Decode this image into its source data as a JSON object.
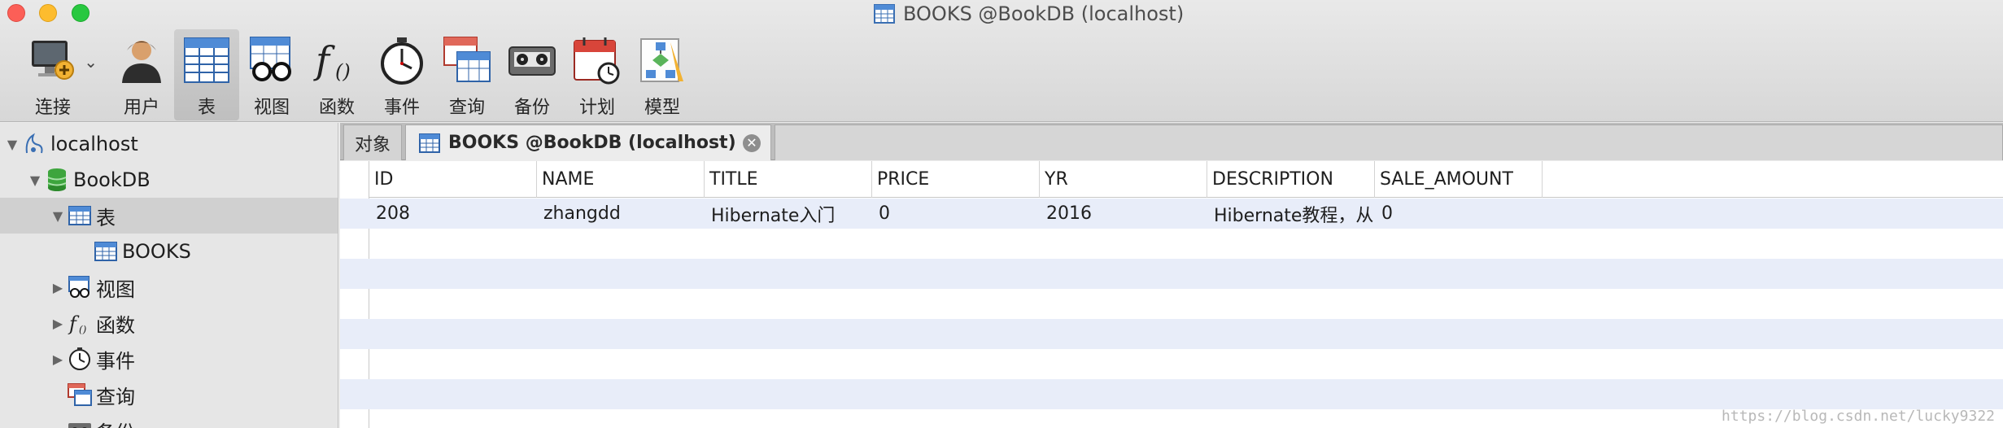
{
  "window": {
    "title": "BOOKS @BookDB (localhost)"
  },
  "toolbar": {
    "items": [
      {
        "label": "连接",
        "icon": "connection-icon"
      },
      {
        "label": "用户",
        "icon": "user-icon"
      },
      {
        "label": "表",
        "icon": "table-icon",
        "active": true
      },
      {
        "label": "视图",
        "icon": "view-icon"
      },
      {
        "label": "函数",
        "icon": "function-icon"
      },
      {
        "label": "事件",
        "icon": "event-icon"
      },
      {
        "label": "查询",
        "icon": "query-icon"
      },
      {
        "label": "备份",
        "icon": "backup-icon"
      },
      {
        "label": "计划",
        "icon": "schedule-icon"
      },
      {
        "label": "模型",
        "icon": "model-icon"
      }
    ]
  },
  "sidebar": {
    "tree": [
      {
        "label": "localhost",
        "icon": "server-icon"
      },
      {
        "label": "BookDB",
        "icon": "database-icon"
      },
      {
        "label": "表",
        "icon": "table-icon"
      },
      {
        "label": "BOOKS",
        "icon": "table-icon"
      },
      {
        "label": "视图",
        "icon": "view-icon"
      },
      {
        "label": "函数",
        "icon": "function-icon"
      },
      {
        "label": "事件",
        "icon": "event-icon"
      },
      {
        "label": "查询",
        "icon": "query-icon"
      },
      {
        "label": "备份",
        "icon": "backup-icon"
      }
    ]
  },
  "tabs": {
    "objects": "对象",
    "active": "BOOKS @BookDB (localhost)"
  },
  "grid": {
    "columns": [
      "ID",
      "NAME",
      "TITLE",
      "PRICE",
      "YR",
      "DESCRIPTION",
      "SALE_AMOUNT"
    ],
    "rows": [
      [
        "208",
        "zhangdd",
        "Hibernate入门",
        "0",
        "2016",
        "Hibernate教程，从",
        "0"
      ]
    ]
  },
  "watermark": "https://blog.csdn.net/lucky9322",
  "colors": {
    "row_alt": "#e8edf9",
    "close_red": "#fc5f57",
    "minimize_yellow": "#fdbc2e",
    "zoom_green": "#28c840"
  }
}
